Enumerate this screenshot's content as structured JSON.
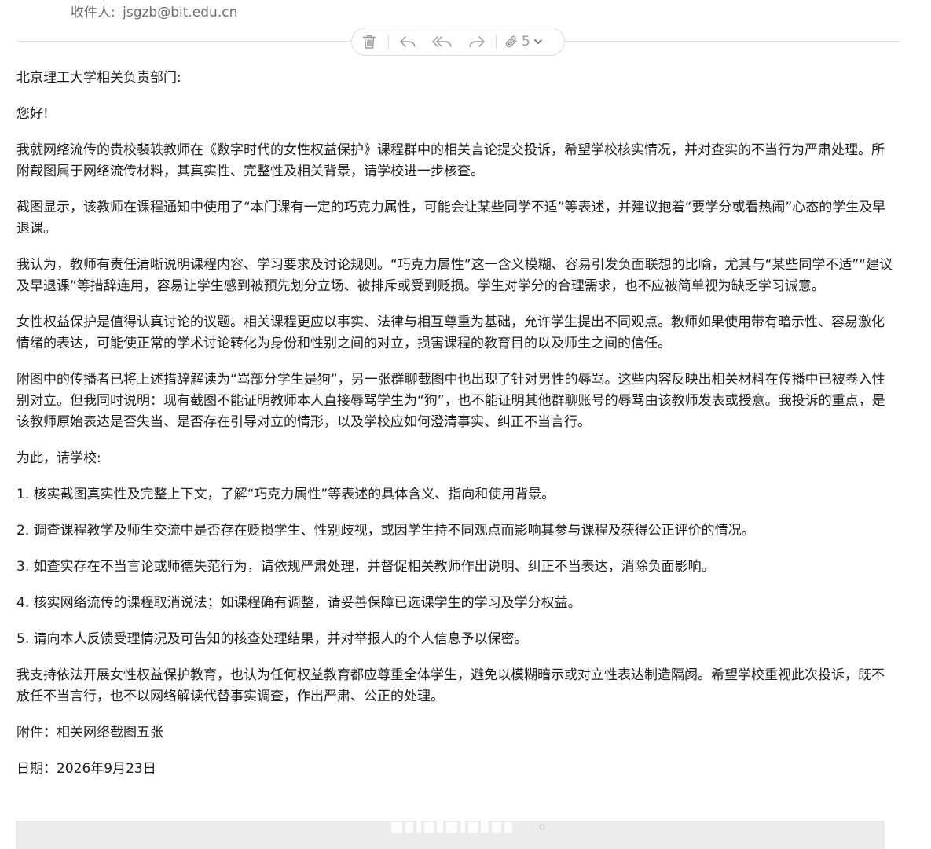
{
  "header": {
    "recipient_label": "收件人:",
    "recipient_address": "jsgzb@bit.edu.cn"
  },
  "toolbar": {
    "icons": [
      "trash-icon",
      "reply-icon",
      "reply-all-icon",
      "forward-icon",
      "paperclip-icon",
      "chevron-down-icon"
    ],
    "attachment_count": "5"
  },
  "body": {
    "salutation": "北京理工大学相关负责部门:",
    "greeting": "您好!",
    "paragraphs": [
      "我就网络流传的贵校裴轶教师在《数字时代的女性权益保护》课程群中的相关言论提交投诉，希望学校核实情况，并对查实的不当行为严肃处理。所附截图属于网络流传材料，其真实性、完整性及相关背景，请学校进一步核查。",
      "截图显示，该教师在课程通知中使用了“本门课有一定的巧克力属性，可能会让某些同学不适”等表述，并建议抱着“要学分或看热闹”心态的学生及早退课。",
      "我认为，教师有责任清晰说明课程内容、学习要求及讨论规则。“巧克力属性”这一含义模糊、容易引发负面联想的比喻，尤其与“某些同学不适”“建议及早退课”等措辞连用，容易让学生感到被预先划分立场、被排斥或受到贬损。学生对学分的合理需求，也不应被简单视为缺乏学习诚意。",
      "女性权益保护是值得认真讨论的议题。相关课程更应以事实、法律与相互尊重为基础，允许学生提出不同观点。教师如果使用带有暗示性、容易激化情绪的表达，可能使正常的学术讨论转化为身份和性别之间的对立，损害课程的教育目的以及师生之间的信任。",
      "附图中的传播者已将上述措辞解读为“骂部分学生是狗”，另一张群聊截图中也出现了针对男性的辱骂。这些内容反映出相关材料在传播中已被卷入性别对立。但我同时说明：现有截图不能证明教师本人直接辱骂学生为“狗”，也不能证明其他群聊账号的辱骂由该教师发表或授意。我投诉的重点，是该教师原始表达是否失当、是否存在引导对立的情形，以及学校应如何澄清事实、纠正不当言行。"
    ],
    "request_intro": "为此，请学校:",
    "requests": [
      "1. 核实截图真实性及完整上下文，了解“巧克力属性”等表述的具体含义、指向和使用背景。",
      "2. 调查课程教学及师生交流中是否存在贬损学生、性别歧视，或因学生持不同观点而影响其参与课程及获得公正评价的情况。",
      "3. 如查实存在不当言论或师德失范行为，请依规严肃处理，并督促相关教师作出说明、纠正不当表达，消除负面影响。",
      "4. 核实网络流传的课程取消说法；如课程确有调整，请妥善保障已选课学生的学习及学分权益。",
      "5. 请向本人反馈受理情况及可告知的核查处理结果，并对举报人的个人信息予以保密。"
    ],
    "closing": "我支持依法开展女性权益保护教育，也认为任何权益教育都应尊重全体学生，避免以模糊暗示或对立性表达制造隔阂。希望学校重视此次投诉，既不放任不当言行，也不以网络解读代替事实调查，作出严肃、公正的处理。",
    "attachment_note": "附件：相关网络截图五张",
    "date_line": "日期：2026年9月23日"
  }
}
